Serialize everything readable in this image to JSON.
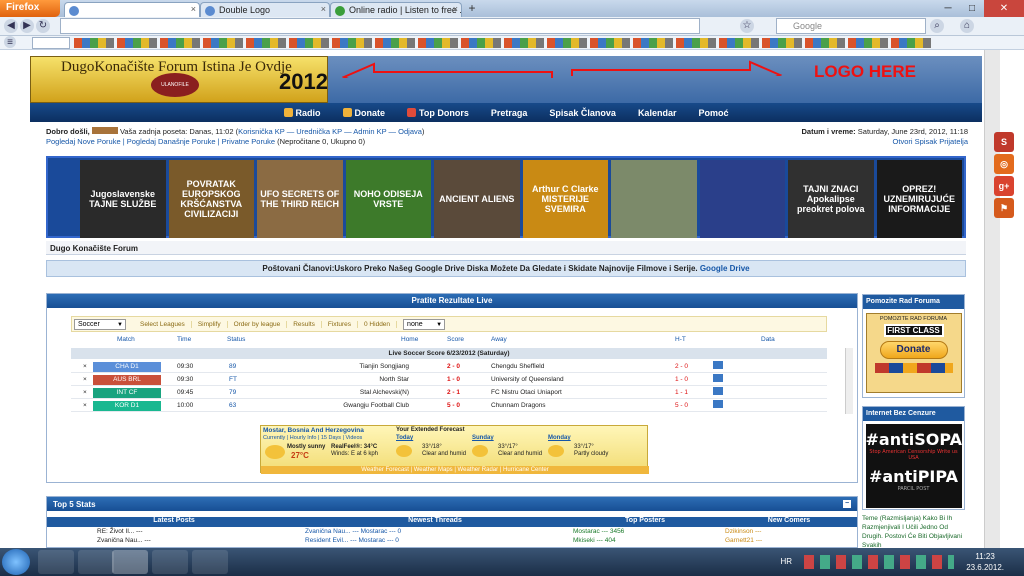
{
  "browser": {
    "app_button": "Firefox",
    "tabs": [
      {
        "label": "",
        "active": true
      },
      {
        "label": "Double Logo",
        "active": false
      },
      {
        "label": "Online radio | Listen to free ...",
        "active": false
      }
    ],
    "search_placeholder": "Google",
    "zoom": ""
  },
  "header": {
    "logo_title": "DugoKonačište Forum Istina Je Ovdje",
    "logo_year": "2012",
    "logo_seal": "ULANOFILE",
    "logo_here": "LOGO HERE"
  },
  "menu": [
    {
      "label": "Radio"
    },
    {
      "label": "Donate"
    },
    {
      "label": "Top Donors"
    },
    {
      "label": "Pretraga"
    },
    {
      "label": "Spisak Članova"
    },
    {
      "label": "Kalendar"
    },
    {
      "label": "Pomoć"
    }
  ],
  "userbar": {
    "welcome": "Dobro došli,",
    "last_visit": "Vaša zadnja poseta: Danas, 11:02 (",
    "links": "Korisnička KP — Urednička KP — Admin KP — Odjava",
    "close": ")",
    "line2": "Pogledaj Nove Poruke | Pogledaj Današnje Poruke | Privatne Poruke",
    "pm": " (Nepročitane 0, Ukupno 0)",
    "datetime_label": "Datum i vreme:",
    "datetime": " Saturday, June 23rd, 2012, 11:18",
    "online": "Otvori Spisak Prijatelja"
  },
  "posters": [
    {
      "text": "Jugoslavenske TAJNE SLUŽBE",
      "color": "#2a2a2a"
    },
    {
      "text": "POVRATAK EUROPSKOG KRŠĆANSTVA CIVILIZACIJI",
      "color": "#7a5a2a"
    },
    {
      "text": "UFO SECRETS OF THE THIRD REICH",
      "color": "#8b6b43"
    },
    {
      "text": "NOHO ODISEJA VRSTE",
      "color": "#3d7a2a"
    },
    {
      "text": "ANCIENT ALIENS",
      "color": "#5a4a3a"
    },
    {
      "text": "Arthur C Clarke MISTERIJE SVEMIRA",
      "color": "#c98a14"
    },
    {
      "text": "",
      "color": "#7c8a6a"
    },
    {
      "text": "",
      "color": "#2a3f8a"
    },
    {
      "text": "TAJNI ZNACI Apokalipse preokret polova",
      "color": "#303030"
    },
    {
      "text": "OPREZ! UZNEMIRUJUĆE INFORMACIJE",
      "color": "#1a1a1a"
    }
  ],
  "forum_title": "Dugo Konačište Forum",
  "announcement": {
    "text": "Poštovani Članovi:Uskoro Preko Našeg Google Drive Diska Možete Da Gledate i Skidate Najnovije Filmove i Serije.",
    "link": " Google Drive"
  },
  "live": {
    "title": "Pratite Rezultate Live",
    "sport": "Soccer",
    "filters": [
      "Select Leagues",
      "Simplify",
      "Order by league",
      "Results",
      "Fixtures"
    ],
    "hidden": "0 Hidden",
    "none_select": "none",
    "columns": [
      "Match",
      "Time",
      "Status",
      "Home",
      "Score",
      "Away",
      "H-T",
      "Data"
    ],
    "subhead": "Live Soccer Score 6/23/2012 (Saturday)",
    "rows": [
      {
        "league": "CHA D1",
        "lcolor": "#5b8fd9",
        "time": "09:30",
        "status": "89",
        "home": "Tianjin Songjiang",
        "score": "2 - 0",
        "away": "Chengdu Sheffield",
        "ht": "2 - 0"
      },
      {
        "league": "AUS BRL",
        "lcolor": "#c9503a",
        "time": "09:30",
        "status": "FT",
        "home": "North Star",
        "score": "1 - 0",
        "away": "University of Queensland",
        "ht": "1 - 0"
      },
      {
        "league": "INT CF",
        "lcolor": "#19a37f",
        "time": "09:45",
        "status": "79",
        "home": "Stal Alchevski(N)",
        "score": "2 - 1",
        "away": "FC Nistru Otaci Uniaport",
        "ht": "1 - 1"
      },
      {
        "league": "KOR D1",
        "lcolor": "#19b890",
        "time": "10:00",
        "status": "63",
        "home": "Gwangju Football Club",
        "score": "5 - 0",
        "away": "Chunnam Dragons",
        "ht": "5 - 0"
      }
    ]
  },
  "weather": {
    "location": "Mostar, Bosnia And Herzegovina",
    "links": "Currently | Hourly Info | 15 Days | Videos",
    "current": "Mostly sunny",
    "temp": "27°C",
    "feels": "RealFeel®: 34°C",
    "wind": "Winds: E at 6 kph",
    "forecast_title": "Your Extended Forecast",
    "days": [
      {
        "name": "Today",
        "temps": "33°/18°",
        "desc": "Clear and humid"
      },
      {
        "name": "Sunday",
        "temps": "33°/17°",
        "desc": "Clear and humid"
      },
      {
        "name": "Monday",
        "temps": "33°/17°",
        "desc": "Partly cloudy"
      }
    ],
    "footer": "Weather Forecast | Weather Maps | Weather Radar | Hurricane Center"
  },
  "top5": {
    "title": "Top 5 Stats",
    "columns": [
      "Latest Posts",
      "Newest Threads",
      "Top Posters",
      "New Comers"
    ],
    "rows": [
      [
        "RE: Život Il... ---",
        "Zvanična Nau... --- Mostarac --- 0",
        "Mostarac --- 3456",
        "Dzikinson ---"
      ],
      [
        "Zvanična Nau... ---",
        "Resident Evil... --- Mostarac --- 0",
        "Mkiseki --- 404",
        "Garnett21 ---"
      ]
    ]
  },
  "sidebar": {
    "donate_title": "Pomozite Rad Foruma",
    "donate_label": "Donate",
    "donate_top": "POMOZITE RAD FORUMA",
    "firstclass": "FIRST CLASS",
    "censor_title": "Internet Bez Cenzure",
    "antisopa": "#antiSOPA",
    "antipipa": "#antiPIPA",
    "sopa_sub": "Stop American Censorship Write us USA",
    "pipa_sub": "PARCIL POST",
    "scroll_text": "Teme (Razmisljanja) Kako Bi Ih Razmjenjivali I Učili Jedno Od Drugih. Postovi Će Biti Objavljivani Svakih"
  },
  "taskbar": {
    "lang": "HR",
    "time": "11:23",
    "date": "23.6.2012."
  },
  "colors": {
    "accent": "#174f94",
    "menubar": "#0c2f60"
  }
}
